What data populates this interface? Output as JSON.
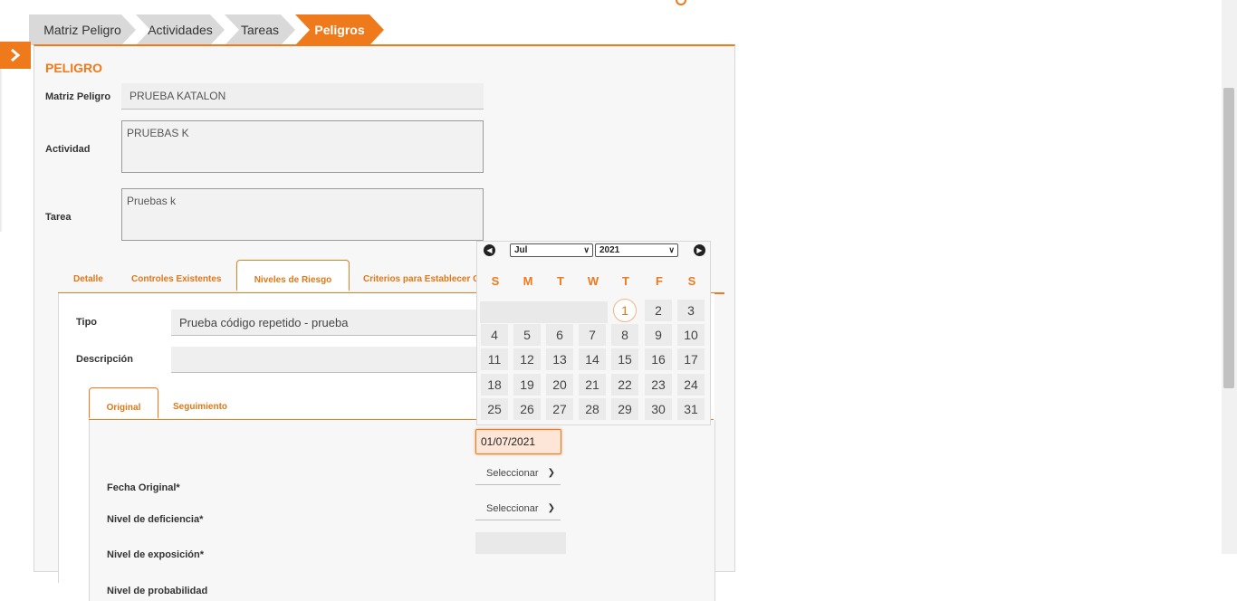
{
  "breadcrumb": [
    "Matriz Peligro",
    "Actividades",
    "Tareas",
    "Peligros"
  ],
  "panel": {
    "title": "PELIGRO",
    "matriz_label": "Matriz Peligro",
    "matriz_value": "PRUEBA KATALON",
    "actividad_label": "Actividad",
    "actividad_value": "PRUEBAS K",
    "tarea_label": "Tarea",
    "tarea_value": "Pruebas k"
  },
  "tabs": [
    "Detalle",
    "Controles Existentes",
    "Niveles de Riesgo",
    "Criterios para Establecer C"
  ],
  "risk": {
    "tipo_label": "Tipo",
    "tipo_value": "Prueba código repetido - prueba",
    "descripcion_label": "Descripción"
  },
  "subtabs": [
    "Original",
    "Seguimiento"
  ],
  "original": {
    "fecha_label": "Fecha Original*",
    "fecha_value": "01/07/2021",
    "deficiencia_label": "Nivel de deficiencia*",
    "deficiencia_value": "Seleccionar",
    "exposicion_label": "Nivel de exposición*",
    "exposicion_value": "Seleccionar",
    "probabilidad_label": "Nivel de probabilidad"
  },
  "calendar": {
    "month": "Jul",
    "year": "2021",
    "weekdays": [
      "S",
      "M",
      "T",
      "W",
      "T",
      "F",
      "S"
    ],
    "days": [
      "1",
      "2",
      "3",
      "4",
      "5",
      "6",
      "7",
      "8",
      "9",
      "10",
      "11",
      "12",
      "13",
      "14",
      "15",
      "16",
      "17",
      "18",
      "19",
      "20",
      "21",
      "22",
      "23",
      "24",
      "25",
      "26",
      "27",
      "28",
      "29",
      "30",
      "31"
    ],
    "selected_day": "1"
  },
  "colors": {
    "accent": "#ee7a1c"
  }
}
